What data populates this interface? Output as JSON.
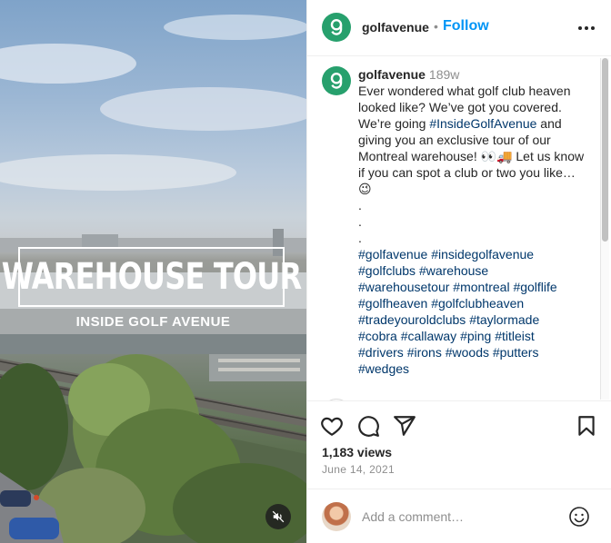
{
  "media": {
    "overlay_title": "WAREHOUSE TOUR",
    "overlay_subtitle": "INSIDE GOLF AVENUE",
    "mute_icon": "speaker-muted-icon"
  },
  "header": {
    "username": "golfavenue",
    "separator": "•",
    "follow_label": "Follow",
    "more_icon": "more-horizontal-icon"
  },
  "caption": {
    "username": "golfavenue",
    "time_ago": "189w",
    "text_before_tag": "Ever wondered what golf club heaven looked like? We’ve got you covered. We’re going ",
    "inline_hashtag": "#InsideGolfAvenue",
    "text_after_tag": " and giving you an exclusive tour of our Montreal warehouse! 👀🚚 Let us know if you can spot a club or two you like… 😉",
    "dots": [
      ".",
      ".",
      "."
    ],
    "hashtags": [
      "#golfavenue",
      "#insidegolfavenue",
      "#golfclubs",
      "#warehouse",
      "#warehousetour",
      "#montreal",
      "#golflife",
      "#golfheaven",
      "#golfclubheaven",
      "#tradeyouroldclubs",
      "#taylormade",
      "#cobra",
      "#callaway",
      "#ping",
      "#titleist",
      "#drivers",
      "#irons",
      "#woods",
      "#putters",
      "#wedges"
    ]
  },
  "stats": {
    "views": "1,183 views",
    "date": "June 14, 2021"
  },
  "comment_box": {
    "placeholder": "Add a comment…",
    "emoji_icon": "smiley-icon"
  },
  "colors": {
    "brand_green": "#27a06d",
    "link_blue": "#0095f6",
    "hashtag_blue": "#00376b",
    "muted_text": "#8e8e8e"
  }
}
